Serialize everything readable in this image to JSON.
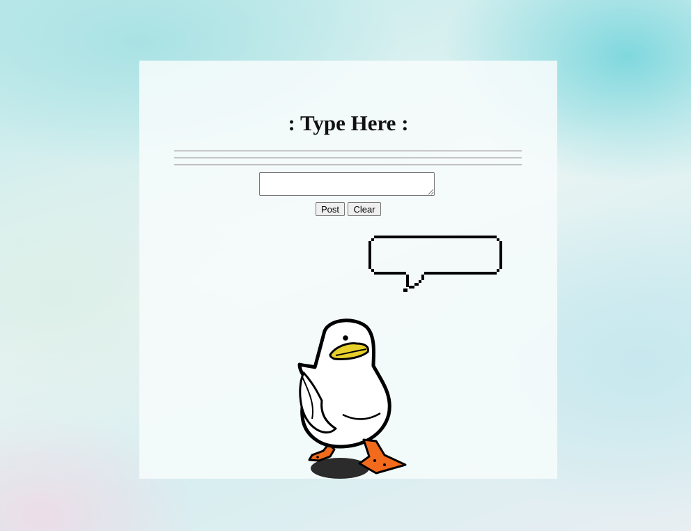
{
  "page": {
    "title": ": Type Here :"
  },
  "composer": {
    "input_value": "",
    "input_placeholder": "",
    "post_label": "Post",
    "clear_label": "Clear"
  },
  "speech_bubble": {
    "text": ""
  },
  "mascot": {
    "icon": "duck-icon"
  },
  "colors": {
    "background_teal": "#7fd8de",
    "panel": "#f7fcfc",
    "duck_beak": "#e8d02c",
    "duck_feet": "#f26a1b",
    "outline": "#000000"
  }
}
